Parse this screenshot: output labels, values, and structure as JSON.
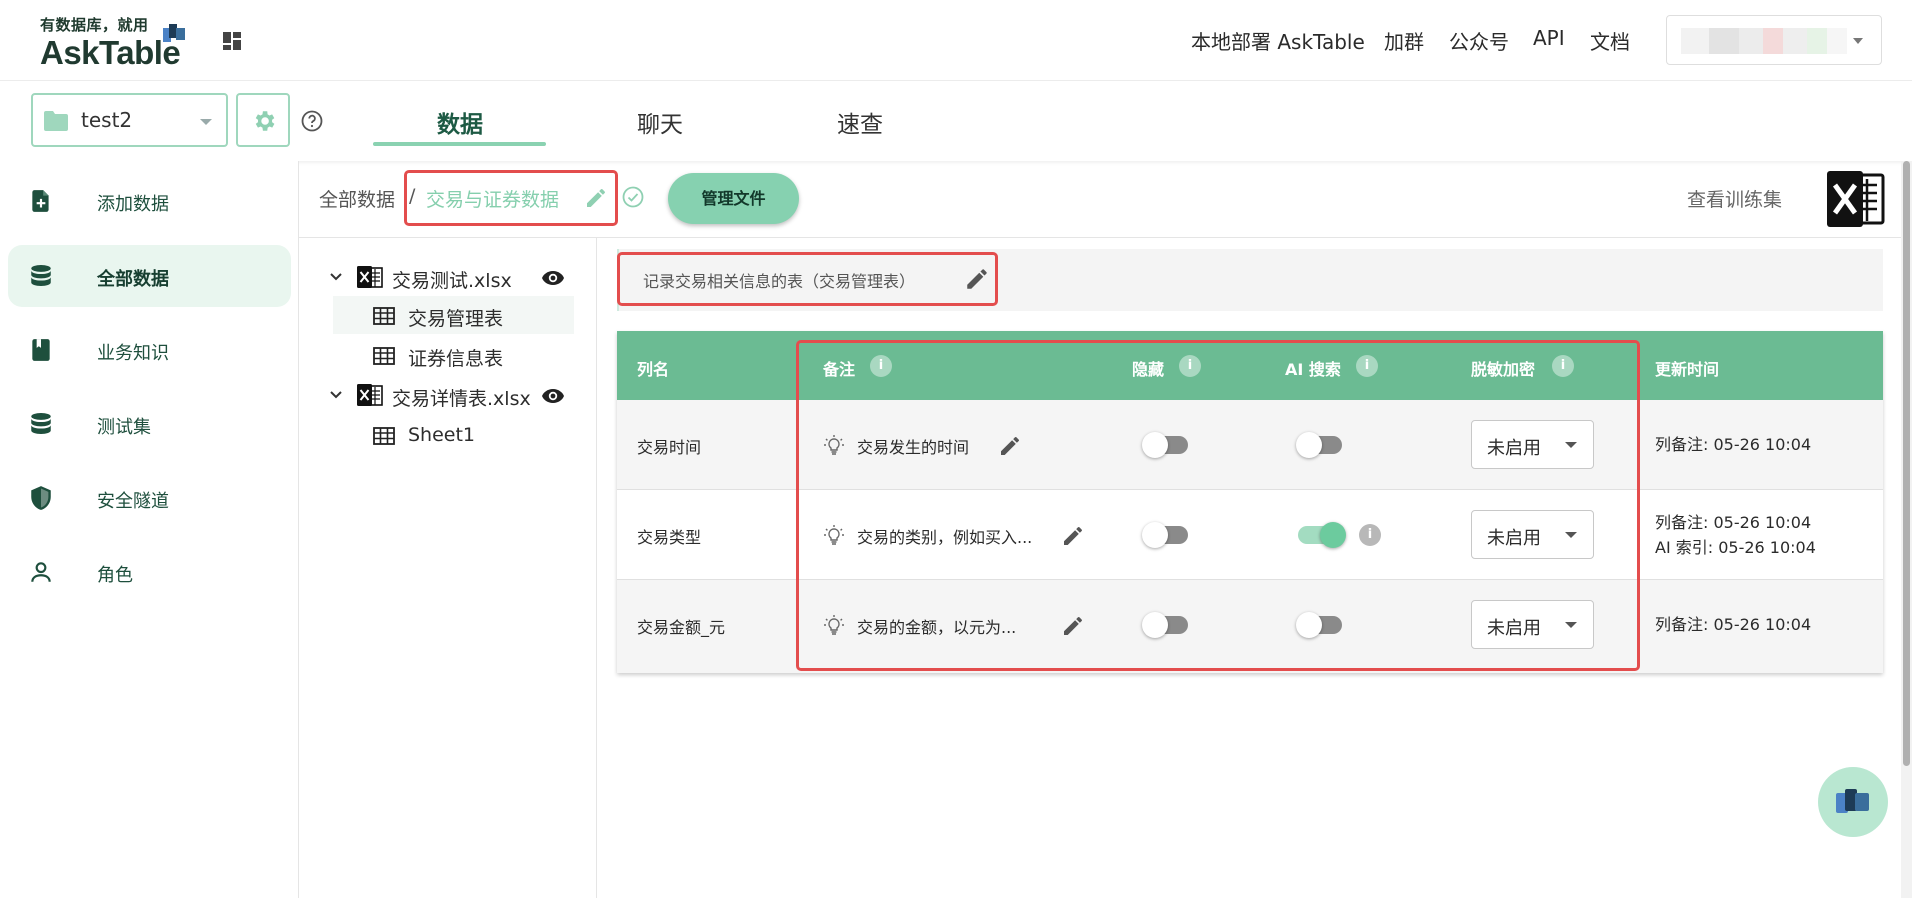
{
  "header": {
    "logo_slogan": "有数据库，就用",
    "logo_brand": "AskTable",
    "nav": [
      "本地部署 AskTable",
      "加群",
      "公众号",
      "API",
      "文档"
    ]
  },
  "toolbar": {
    "project_name": "test2",
    "tabs": [
      "数据",
      "聊天",
      "速查"
    ],
    "active_tab": "数据"
  },
  "sidebar": {
    "items": [
      {
        "label": "添加数据",
        "icon": "file-add-icon"
      },
      {
        "label": "全部数据",
        "icon": "database-icon",
        "active": true
      },
      {
        "label": "业务知识",
        "icon": "book-icon"
      },
      {
        "label": "测试集",
        "icon": "database-icon"
      },
      {
        "label": "安全隧道",
        "icon": "shield-icon"
      },
      {
        "label": "角色",
        "icon": "person-icon"
      }
    ]
  },
  "breadcrumb": {
    "root": "全部数据",
    "separator": "/",
    "current": "交易与证券数据",
    "manage_files": "管理文件",
    "training_set": "查看训练集"
  },
  "tree": {
    "files": [
      {
        "name": "交易测试.xlsx",
        "tables": [
          "交易管理表",
          "证券信息表"
        ]
      },
      {
        "name": "交易详情表.xlsx",
        "tables": [
          "Sheet1"
        ]
      }
    ],
    "selected_table": "交易管理表"
  },
  "table_description": "记录交易相关信息的表（交易管理表）",
  "columns_table": {
    "headers": {
      "name": "列名",
      "note": "备注",
      "hidden": "隐藏",
      "ai_search": "AI 搜索",
      "masking": "脱敏加密",
      "updated": "更新时间"
    },
    "rows": [
      {
        "name": "交易时间",
        "note": "交易发生的时间",
        "hidden": false,
        "ai_search": false,
        "masking": "未启用",
        "updated": [
          "列备注: 05-26 10:04"
        ]
      },
      {
        "name": "交易类型",
        "note": "交易的类别，例如买入...",
        "hidden": false,
        "ai_search": true,
        "masking": "未启用",
        "updated": [
          "列备注: 05-26 10:04",
          "AI 索引: 05-26 10:04"
        ]
      },
      {
        "name": "交易金额_元",
        "note": "交易的金额，以元为...",
        "hidden": false,
        "ai_search": false,
        "masking": "未启用",
        "updated": [
          "列备注: 05-26 10:04"
        ]
      }
    ]
  },
  "colors": {
    "accent": "#6bbb93",
    "accent_light": "#86d1b0",
    "highlight_box": "#e34d4d",
    "dark_green": "#1e4f3d"
  }
}
